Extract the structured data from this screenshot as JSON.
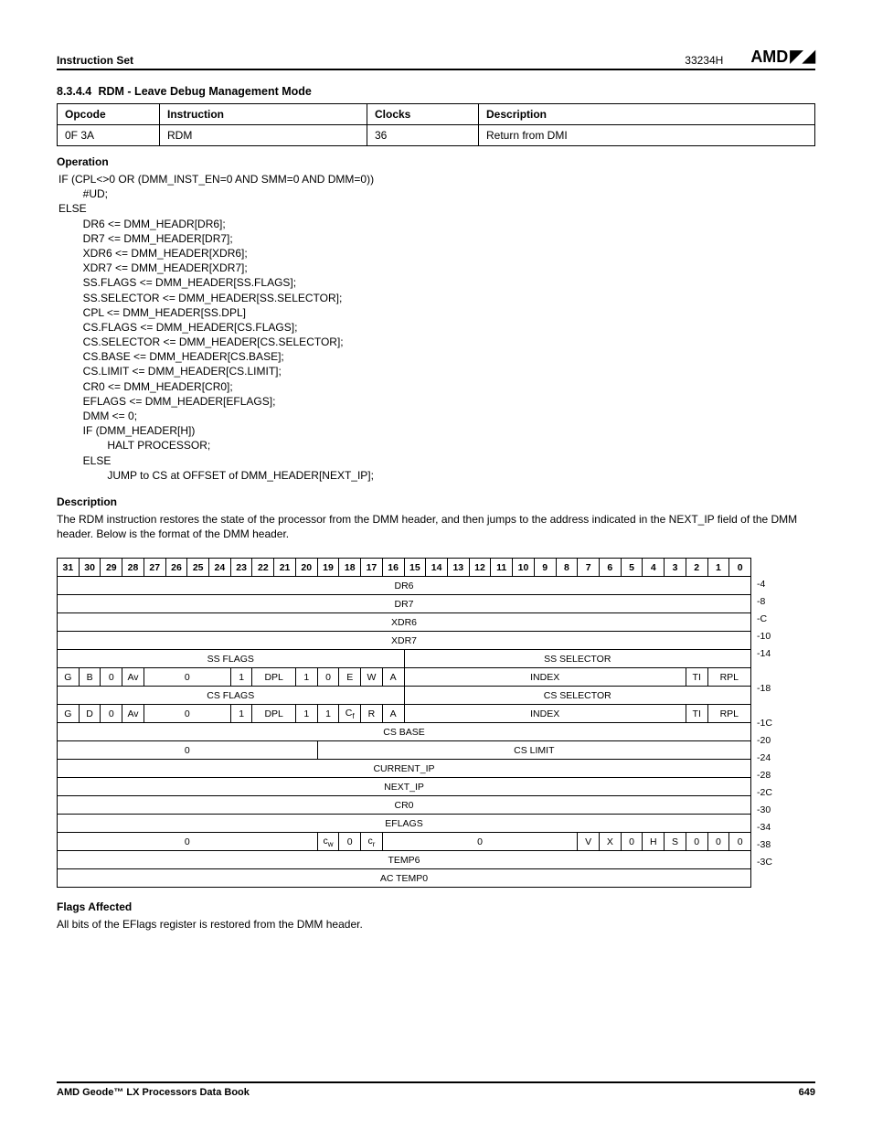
{
  "header": {
    "section_left": "Instruction Set",
    "doc_id": "33234H",
    "brand": "AMD"
  },
  "section": {
    "number": "8.3.4.4",
    "title": "RDM - Leave Debug Management Mode"
  },
  "inst_table": {
    "headers": [
      "Opcode",
      "Instruction",
      "Clocks",
      "Description"
    ],
    "row": [
      "0F 3A",
      "RDM",
      "36",
      "Return from DMI"
    ]
  },
  "operation": {
    "heading": "Operation",
    "code": "IF (CPL<>0 OR (DMM_INST_EN=0 AND SMM=0 AND DMM=0))\n        #UD;\nELSE\n        DR6 <= DMM_HEADR[DR6];\n        DR7 <= DMM_HEADER[DR7];\n        XDR6 <= DMM_HEADER[XDR6];\n        XDR7 <= DMM_HEADER[XDR7];\n        SS.FLAGS <= DMM_HEADER[SS.FLAGS];\n        SS.SELECTOR <= DMM_HEADER[SS.SELECTOR];\n        CPL <= DMM_HEADER[SS.DPL]\n        CS.FLAGS <= DMM_HEADER[CS.FLAGS];\n        CS.SELECTOR <= DMM_HEADER[CS.SELECTOR];\n        CS.BASE <= DMM_HEADER[CS.BASE];\n        CS.LIMIT <= DMM_HEADER[CS.LIMIT];\n        CR0 <= DMM_HEADER[CR0];\n        EFLAGS <= DMM_HEADER[EFLAGS];\n        DMM <= 0;\n        IF (DMM_HEADER[H])\n                HALT PROCESSOR;\n        ELSE\n                JUMP to CS at OFFSET of DMM_HEADER[NEXT_IP];"
  },
  "description": {
    "heading": "Description",
    "text": "The RDM instruction restores the state of the processor from the DMM header, and then jumps to the address indicated in the NEXT_IP field of the DMM header. Below is the format of the DMM header."
  },
  "dmm": {
    "bit_cols": [
      "31",
      "30",
      "29",
      "28",
      "27",
      "26",
      "25",
      "24",
      "23",
      "22",
      "21",
      "20",
      "19",
      "18",
      "17",
      "16",
      "15",
      "14",
      "13",
      "12",
      "11",
      "10",
      "9",
      "8",
      "7",
      "6",
      "5",
      "4",
      "3",
      "2",
      "1",
      "0"
    ],
    "rows_full": {
      "dr6": "DR6",
      "dr7": "DR7",
      "xdr6": "XDR6",
      "xdr7": "XDR7"
    },
    "ss_header": {
      "flags": "SS FLAGS",
      "selector": "SS SELECTOR"
    },
    "ss_row": {
      "g": "G",
      "b": "B",
      "z1": "0",
      "av": "Av",
      "z2": "0",
      "one": "1",
      "dpl": "DPL",
      "one2": "1",
      "z3": "0",
      "e": "E",
      "w": "W",
      "a": "A",
      "index": "INDEX",
      "ti": "TI",
      "rpl": "RPL"
    },
    "cs_header": {
      "flags": "CS FLAGS",
      "selector": "CS SELECTOR"
    },
    "cs_row": {
      "g": "G",
      "d": "D",
      "z1": "0",
      "av": "Av",
      "z2": "0",
      "one": "1",
      "dpl": "DPL",
      "one2": "1",
      "one3": "1",
      "cf": "C",
      "cf_sub": "f",
      "r": "R",
      "a": "A",
      "index": "INDEX",
      "ti": "TI",
      "rpl": "RPL"
    },
    "csbase": "CS BASE",
    "cslimit_row": {
      "zero": "0",
      "cslimit": "CS LIMIT"
    },
    "current_ip": "CURRENT_IP",
    "next_ip": "NEXT_IP",
    "cr0": "CR0",
    "eflags": "EFLAGS",
    "fp_row": {
      "zero1": "0",
      "cw": "c",
      "cw_sub": "w",
      "z": "0",
      "cr": "c",
      "cr_sub": "r",
      "zero2": "0",
      "v": "V",
      "x": "X",
      "z2": "0",
      "h": "H",
      "s": "S",
      "z3": "0",
      "z4": "0",
      "z5": "0"
    },
    "temp6": "TEMP6",
    "actemp0": "AC TEMP0",
    "offsets": [
      "-4",
      "-8",
      "-C",
      "-10",
      "-14",
      "",
      "-18",
      "",
      "-1C",
      "-20",
      "-24",
      "-28",
      "-2C",
      "-30",
      "-34",
      "-38",
      "-3C"
    ]
  },
  "flags": {
    "heading": "Flags Affected",
    "text": "All bits of the EFlags register is restored from the DMM header."
  },
  "footer": {
    "left": "AMD Geode™ LX Processors Data Book",
    "page": "649"
  }
}
